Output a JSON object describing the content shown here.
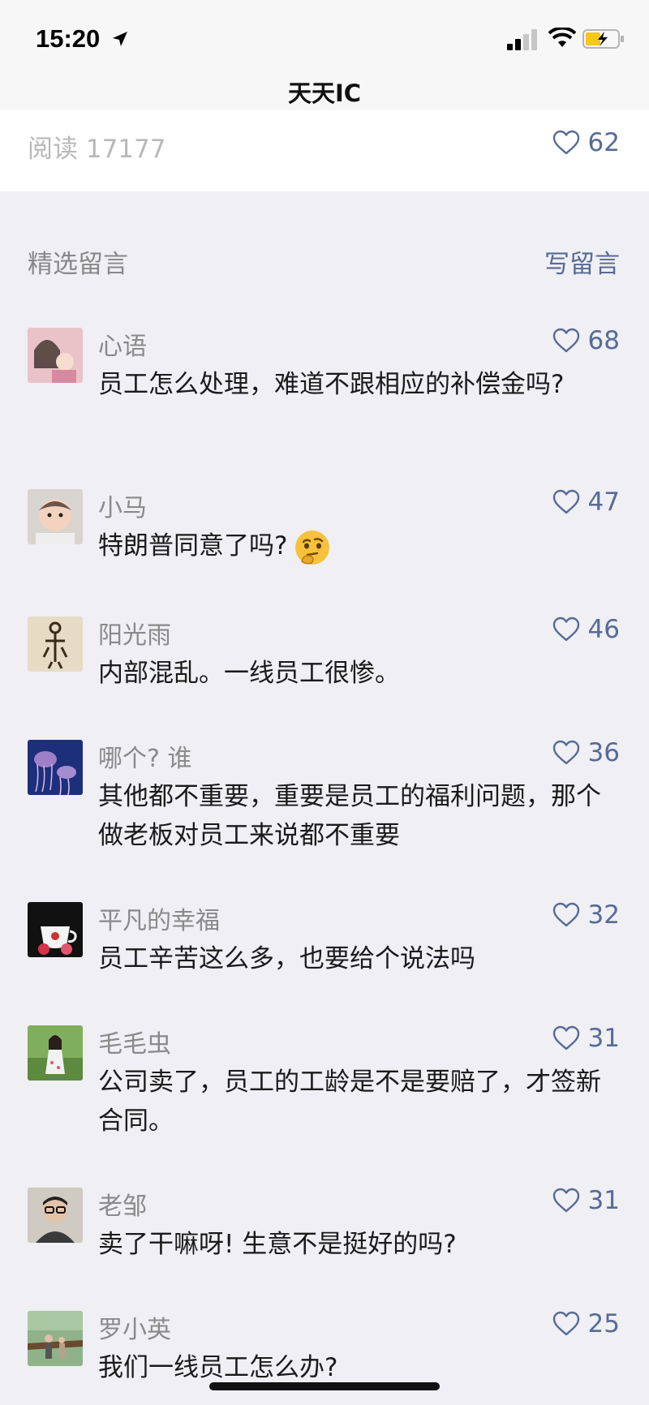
{
  "status_bar": {
    "time": "15:20"
  },
  "nav": {
    "title": "天天IC"
  },
  "article": {
    "read_label": "阅读 17177",
    "likes": "62"
  },
  "comments_section": {
    "title": "精选留言",
    "write_label": "写留言"
  },
  "comments": [
    {
      "name": "心语",
      "likes": "68",
      "text": "员工怎么处理，难道不跟相应的补偿金吗?"
    },
    {
      "name": "小马",
      "likes": "47",
      "text": "特朗普同意了吗?"
    },
    {
      "name": "阳光雨",
      "likes": "46",
      "text": "内部混乱。一线员工很惨。"
    },
    {
      "name": "哪个? 谁",
      "likes": "36",
      "text": "其他都不重要，重要是员工的福利问题，那个做老板对员工来说都不重要"
    },
    {
      "name": "平凡的幸福",
      "likes": "32",
      "text": "员工辛苦这么多，也要给个说法吗"
    },
    {
      "name": "毛毛虫",
      "likes": "31",
      "text": "公司卖了，员工的工龄是不是要赔了，才签新合同。"
    },
    {
      "name": "老邹",
      "likes": "31",
      "text": "卖了干嘛呀! 生意不是挺好的吗?"
    },
    {
      "name": "罗小英",
      "likes": "25",
      "text": "我们一线员工怎么办?"
    }
  ],
  "colors": {
    "link_blue": "#576b95",
    "background": "#efeff4"
  },
  "icons": [
    "location-arrow-icon",
    "signal-icon",
    "wifi-icon",
    "battery-charging-icon",
    "heart-icon",
    "thinking-face-emoji"
  ]
}
